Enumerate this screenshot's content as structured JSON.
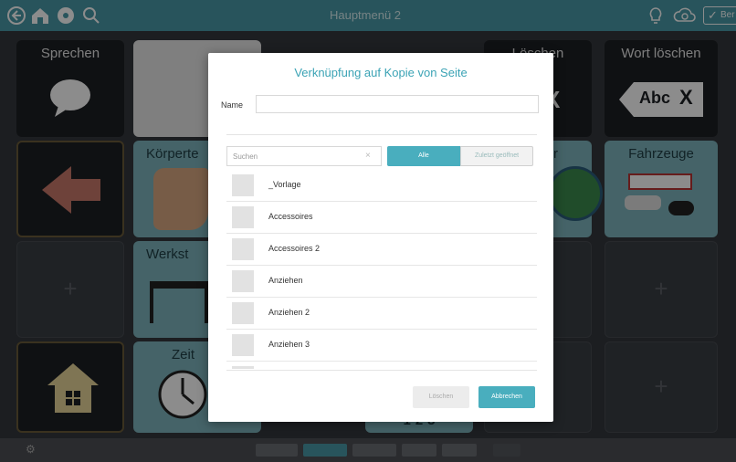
{
  "topbar": {
    "title": "Hauptmenü 2",
    "right_label": "Ber"
  },
  "grid": {
    "cells": {
      "speak": "Sprechen",
      "delete": "Löschen",
      "delete_word": "Wort löschen",
      "body": "Körperte",
      "vehicles": "Fahrzeuge",
      "workshop": "Werkst",
      "time": "Zeit",
      "numbers": "1-2-3",
      "r": "r"
    },
    "abc_label": "Abc"
  },
  "dialog": {
    "title": "Verknüpfung auf Kopie von Seite",
    "name_label": "Name",
    "name_value": "",
    "search_placeholder": "Suchen",
    "filter_all": "Alle",
    "filter_recent": "Zuletzt geöffnet",
    "pages": [
      "_Vorlage",
      "Accessoires",
      "Accessoires 2",
      "Anziehen",
      "Anziehen 2",
      "Anziehen 3"
    ],
    "delete_label": "Löschen",
    "cancel_label": "Abbrechen"
  },
  "colors": {
    "accent": "#49aebe",
    "topbar": "#4a9aa8",
    "cell_teal": "#7fb5bd",
    "cell_dark": "#1d1f23"
  }
}
